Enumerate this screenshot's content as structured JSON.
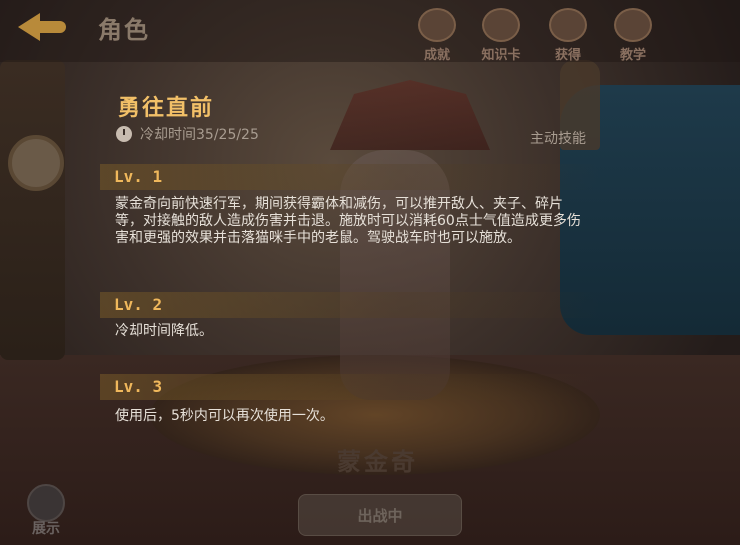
{
  "header": {
    "title": "角色",
    "nav": [
      {
        "label": "成就",
        "icon": "trophy-icon"
      },
      {
        "label": "知识卡",
        "icon": "card-icon"
      },
      {
        "label": "获得",
        "icon": "gift-icon"
      },
      {
        "label": "教学",
        "icon": "book-icon"
      }
    ]
  },
  "skill": {
    "name": "勇往直前",
    "cooldown": "冷却时间35/25/25",
    "type": "主动技能",
    "levels": [
      {
        "label": "Lv. 1",
        "desc": "蒙金奇向前快速行军，期间获得霸体和减伤，可以推开敌人、夹子、碎片等，对接触的敌人造成伤害并击退。施放时可以消耗60点士气值造成更多伤害和更强的效果并击落猫咪手中的老鼠。驾驶战车时也可以施放。"
      },
      {
        "label": "Lv. 2",
        "desc": "冷却时间降低。"
      },
      {
        "label": "Lv. 3",
        "desc": "使用后，5秒内可以再次使用一次。"
      }
    ]
  },
  "footer": {
    "character_name": "蒙金奇",
    "battle_label": "出战中",
    "showcase_label": "展示"
  },
  "colors": {
    "skill_title": "#f2c068",
    "level_label": "#f0b85c",
    "desc_text": "#e6e0d8",
    "muted_text": "#a89c90"
  }
}
